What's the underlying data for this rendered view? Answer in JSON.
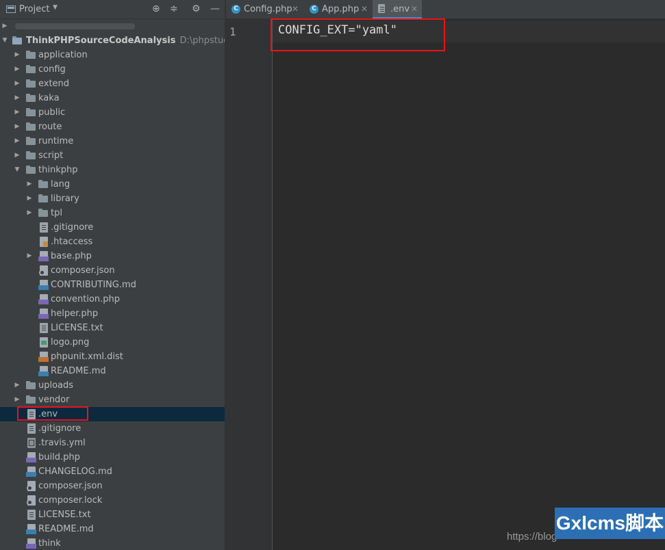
{
  "project_panel": {
    "title": "Project",
    "root": {
      "name": "ThinkPHPSourceCodeAnalysis",
      "path": "D:\\phpstudy_pro\\"
    },
    "tree": [
      {
        "label": "application",
        "type": "folder",
        "level": 1,
        "expandable": true
      },
      {
        "label": "config",
        "type": "folder",
        "level": 1,
        "expandable": true
      },
      {
        "label": "extend",
        "type": "folder",
        "level": 1,
        "expandable": true
      },
      {
        "label": "kaka",
        "type": "folder",
        "level": 1,
        "expandable": true
      },
      {
        "label": "public",
        "type": "folder",
        "level": 1,
        "expandable": true
      },
      {
        "label": "route",
        "type": "folder",
        "level": 1,
        "expandable": true
      },
      {
        "label": "runtime",
        "type": "folder",
        "level": 1,
        "expandable": true
      },
      {
        "label": "script",
        "type": "folder",
        "level": 1,
        "expandable": true
      },
      {
        "label": "thinkphp",
        "type": "folder",
        "level": 1,
        "expandable": true,
        "expanded": true
      },
      {
        "label": "lang",
        "type": "folder",
        "level": 2,
        "expandable": true
      },
      {
        "label": "library",
        "type": "folder",
        "level": 2,
        "expandable": true
      },
      {
        "label": "tpl",
        "type": "folder",
        "level": 2,
        "expandable": true
      },
      {
        "label": ".gitignore",
        "type": "plain",
        "level": 2
      },
      {
        "label": ".htaccess",
        "type": "hta",
        "level": 2
      },
      {
        "label": "base.php",
        "type": "php",
        "level": 2,
        "expandable": true
      },
      {
        "label": "composer.json",
        "type": "cfg",
        "level": 2
      },
      {
        "label": "CONTRIBUTING.md",
        "type": "md",
        "level": 2
      },
      {
        "label": "convention.php",
        "type": "php",
        "level": 2
      },
      {
        "label": "helper.php",
        "type": "php",
        "level": 2
      },
      {
        "label": "LICENSE.txt",
        "type": "plain",
        "level": 2
      },
      {
        "label": "logo.png",
        "type": "img",
        "level": 2
      },
      {
        "label": "phpunit.xml.dist",
        "type": "xml",
        "level": 2
      },
      {
        "label": "README.md",
        "type": "md",
        "level": 2
      },
      {
        "label": "uploads",
        "type": "folder",
        "level": 1,
        "expandable": true
      },
      {
        "label": "vendor",
        "type": "folder",
        "level": 1,
        "expandable": true
      },
      {
        "label": ".env",
        "type": "plain",
        "level": 1,
        "selected": true
      },
      {
        "label": ".gitignore",
        "type": "plain",
        "level": 1
      },
      {
        "label": ".travis.yml",
        "type": "yml",
        "level": 1
      },
      {
        "label": "build.php",
        "type": "php",
        "level": 1
      },
      {
        "label": "CHANGELOG.md",
        "type": "md",
        "level": 1
      },
      {
        "label": "composer.json",
        "type": "cfg",
        "level": 1
      },
      {
        "label": "composer.lock",
        "type": "cfg",
        "level": 1
      },
      {
        "label": "LICENSE.txt",
        "type": "plain",
        "level": 1
      },
      {
        "label": "README.md",
        "type": "md",
        "level": 1
      },
      {
        "label": "think",
        "type": "php",
        "level": 1
      }
    ]
  },
  "tabs": [
    {
      "label": "Config.php",
      "icon": "class-icon",
      "active": false
    },
    {
      "label": "App.php",
      "icon": "class-icon",
      "active": false
    },
    {
      "label": ".env",
      "icon": "text-file-icon",
      "active": true
    }
  ],
  "editor": {
    "line_number": "1",
    "code": "CONFIG_EXT=\"yaml\""
  },
  "watermark": {
    "url": "https://blog",
    "brand": "Gxlcms脚本"
  },
  "colors": {
    "highlight": "#e8141a",
    "panel_bg": "#3c3f41",
    "editor_bg": "#2b2b2b",
    "tab_accent": "#4a88c7"
  }
}
